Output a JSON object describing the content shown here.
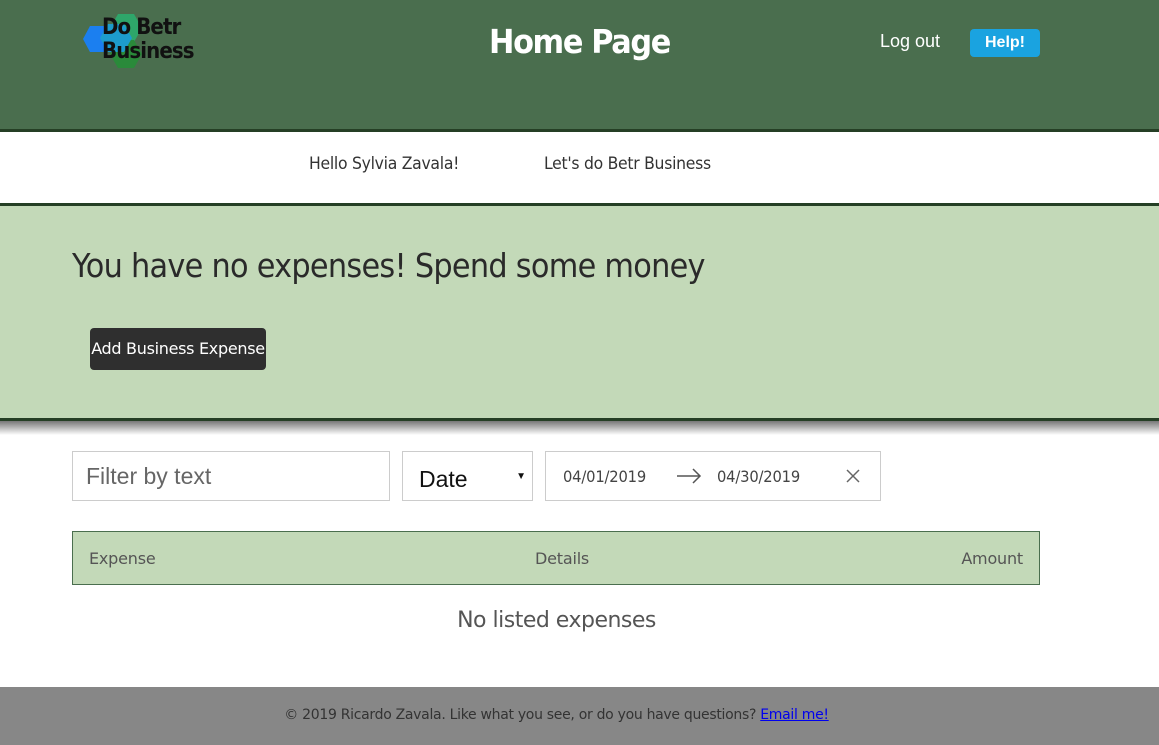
{
  "header": {
    "logo_text_line1": "Do Betr",
    "logo_text_line2": "Business",
    "title": "Home Page",
    "logout_label": "Log out",
    "help_label": "Help!"
  },
  "greeting": {
    "hello": "Hello Sylvia Zavala!",
    "tagline": "Let's do Betr Business"
  },
  "banner": {
    "message": "You have no expenses! Spend some money",
    "add_button_label": "Add Business Expense"
  },
  "filters": {
    "text_placeholder": "Filter by text",
    "sort_selected": "Date",
    "start_date": "04/01/2019",
    "end_date": "04/30/2019"
  },
  "table": {
    "columns": [
      "Expense",
      "Details",
      "Amount"
    ],
    "empty_message": "No listed expenses"
  },
  "footer": {
    "text": "© 2019 Ricardo Zavala. Like what you see, or do you have questions?",
    "link_label": "Email me!"
  },
  "colors": {
    "header_bg": "#4a6e4e",
    "banner_bg": "#c3d9b8",
    "help_button": "#1aa3e0",
    "footer_bg": "#878787"
  }
}
